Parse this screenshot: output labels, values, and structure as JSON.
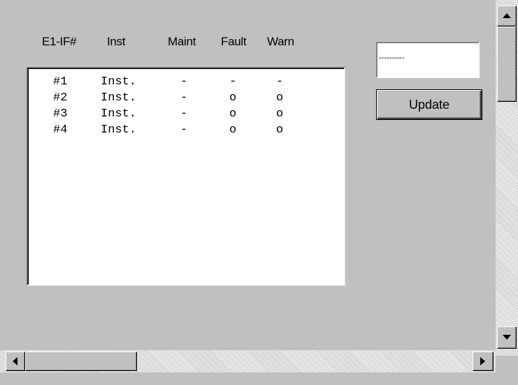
{
  "headers": {
    "e1if": "E1-IF#",
    "inst": "Inst",
    "maint": "Maint",
    "fault": "Fault",
    "warn": "Warn"
  },
  "rows": [
    {
      "num": "#1",
      "inst": "Inst.",
      "maint": "-",
      "fault": "-",
      "warn": "-"
    },
    {
      "num": "#2",
      "inst": "Inst.",
      "maint": "-",
      "fault": "o",
      "warn": "o"
    },
    {
      "num": "#3",
      "inst": "Inst.",
      "maint": "-",
      "fault": "o",
      "warn": "o"
    },
    {
      "num": "#4",
      "inst": "Inst.",
      "maint": "-",
      "fault": "o",
      "warn": "o"
    }
  ],
  "textbox": {
    "value": "----------"
  },
  "update_button": {
    "label": "Update"
  },
  "scrollbars": {
    "vertical": {
      "up_icon": "arrow-up-icon",
      "down_icon": "arrow-down-icon"
    },
    "horizontal": {
      "left_icon": "arrow-left-icon",
      "right_icon": "arrow-right-icon"
    }
  }
}
